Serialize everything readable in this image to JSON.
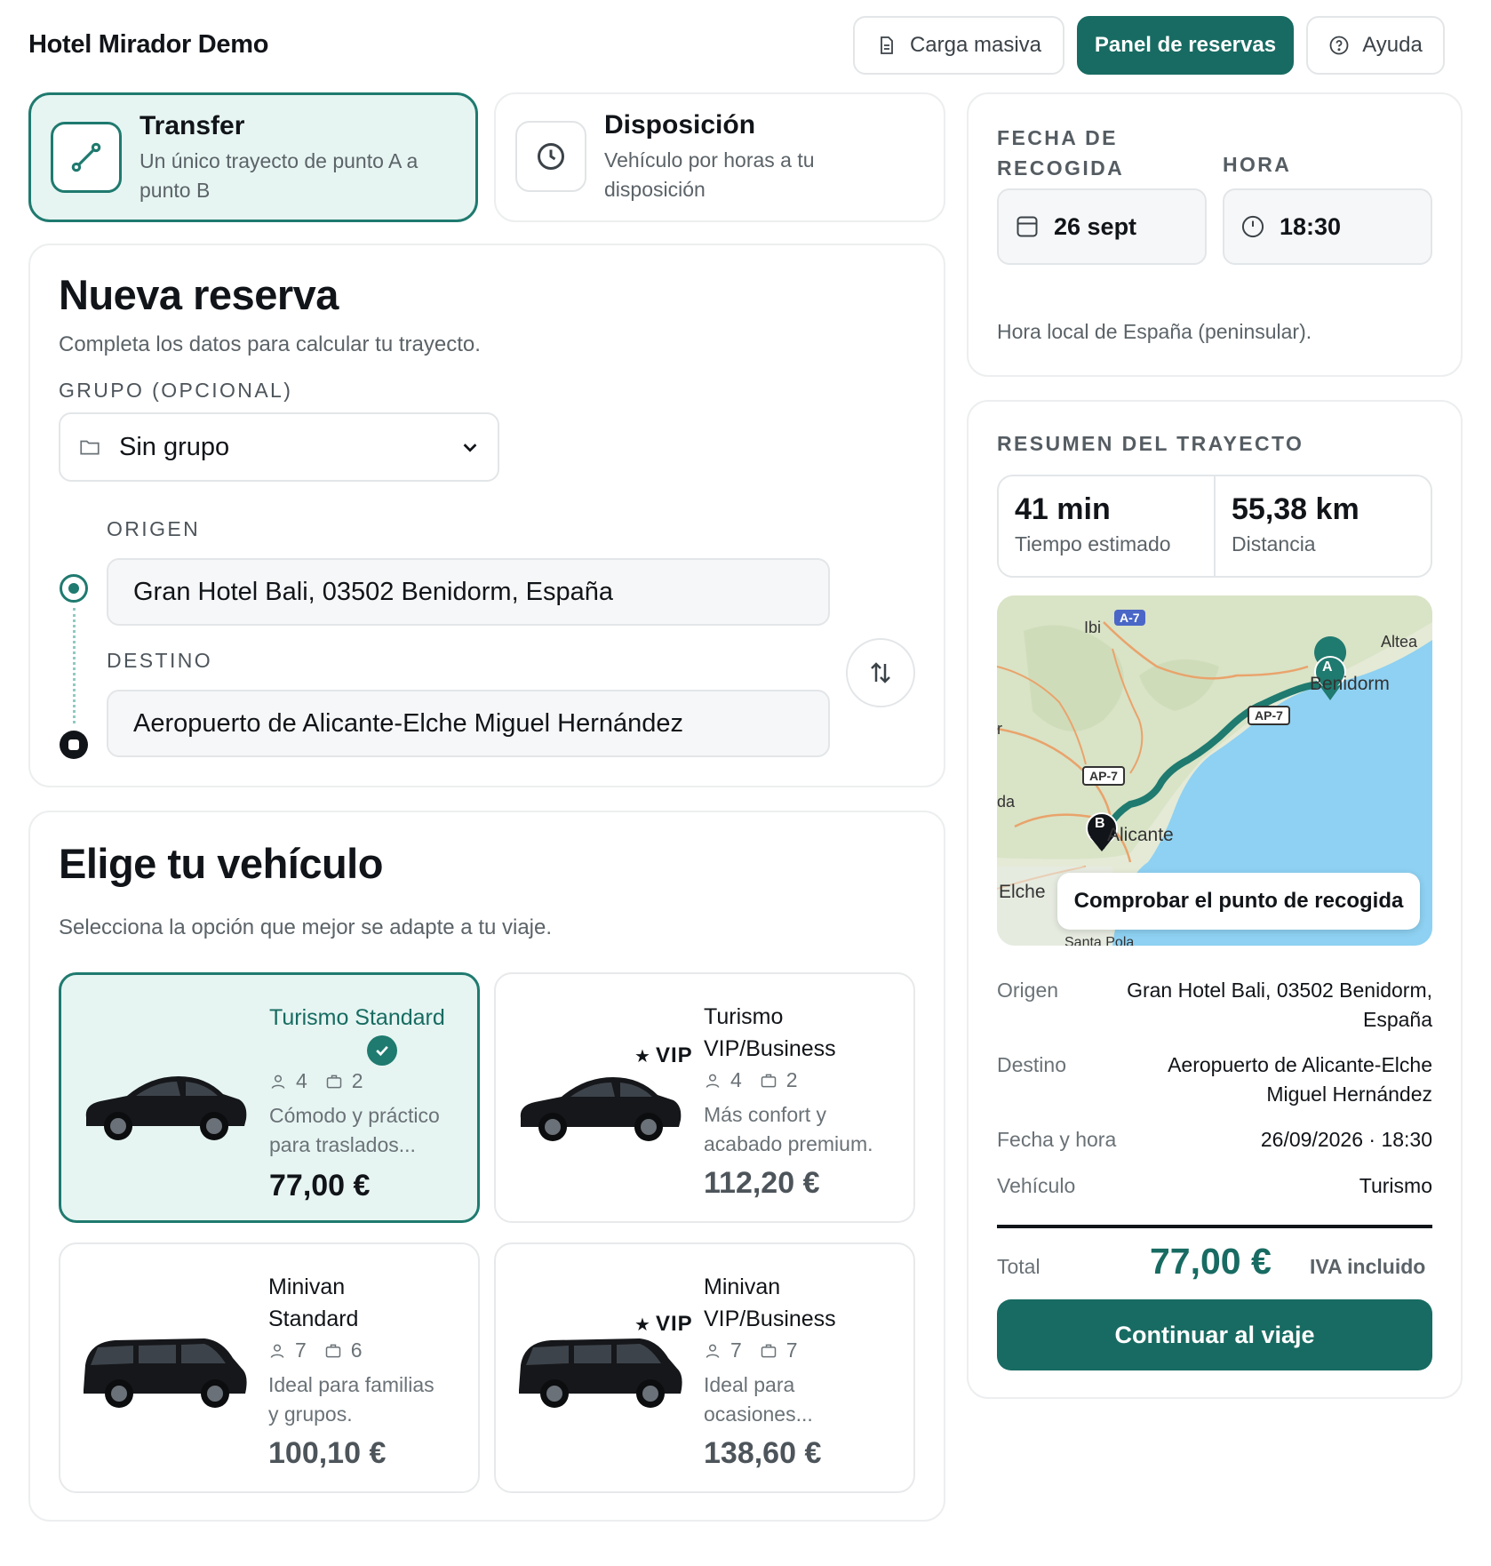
{
  "header": {
    "brand": "Hotel Mirador Demo",
    "bulk_label": "Carga masiva",
    "panel_label": "Panel de reservas",
    "help_label": "Ayuda"
  },
  "service_types": [
    {
      "title": "Transfer",
      "desc": "Un único trayecto de punto A a punto B",
      "selected": true
    },
    {
      "title": "Disposición",
      "desc": "Vehículo por horas a tu disposición",
      "selected": false
    }
  ],
  "new_booking": {
    "title": "Nueva reserva",
    "subtitle": "Completa los datos para calcular tu trayecto.",
    "group_label": "GRUPO (OPCIONAL)",
    "group_value": "Sin grupo",
    "origin_label": "ORIGEN",
    "origin_value": "Gran Hotel Bali, 03502 Benidorm, España",
    "destination_label": "DESTINO",
    "destination_value": "Aeropuerto de Alicante-Elche Miguel Hernández"
  },
  "vehicles_section": {
    "title": "Elige tu vehículo",
    "subtitle": "Selecciona la opción que mejor se adapte a tu viaje.",
    "vip_label": "VIP",
    "items": [
      {
        "name": "Turismo Standard",
        "pax": "4",
        "bags": "2",
        "desc_l1": "Cómodo y práctico",
        "desc_l2": "para traslados...",
        "price": "77,00 €",
        "selected": true,
        "vip": false
      },
      {
        "name_l1": "Turismo",
        "name_l2": "VIP/Business",
        "pax": "4",
        "bags": "2",
        "desc_l1": "Más confort y",
        "desc_l2": "acabado premium.",
        "price": "112,20 €",
        "selected": false,
        "vip": true
      },
      {
        "name_l1": "Minivan",
        "name_l2": "Standard",
        "pax": "7",
        "bags": "6",
        "desc_l1": "Ideal para familias",
        "desc_l2": "y grupos.",
        "price": "100,10 €",
        "selected": false,
        "vip": false
      },
      {
        "name_l1": "Minivan",
        "name_l2": "VIP/Business",
        "pax": "7",
        "bags": "7",
        "desc_l1": "Ideal para",
        "desc_l2": "ocasiones...",
        "price": "138,60 €",
        "selected": false,
        "vip": true
      }
    ]
  },
  "pickup": {
    "date_label_l1": "FECHA DE",
    "date_label_l2": "RECOGIDA",
    "time_label": "HORA",
    "date_value": "26 sept",
    "time_value": "18:30",
    "note": "Hora local de España (peninsular)."
  },
  "summary": {
    "title": "RESUMEN DEL TRAYECTO",
    "time_value": "41 min",
    "time_label": "Tiempo estimado",
    "distance_value": "55,38 km",
    "distance_label": "Distancia",
    "map": {
      "check_pickup_label": "Comprobar el punto de recogida",
      "marker_a": "A",
      "marker_b": "B",
      "places": [
        "Ibi",
        "Altea",
        "Benidorm",
        "Alicante",
        "Elche",
        "Santa Pola",
        "r",
        "da"
      ],
      "roads": [
        "A-7",
        "AP-7",
        "AP-7"
      ]
    },
    "rows": {
      "origin_key": "Origen",
      "origin_l1": "Gran Hotel Bali, 03502 Benidorm,",
      "origin_l2": "España",
      "dest_key": "Destino",
      "dest_l1": "Aeropuerto de Alicante-Elche",
      "dest_l2": "Miguel Hernández",
      "datetime_key": "Fecha y hora",
      "datetime_value": "26/09/2026 · 18:30",
      "vehicle_key": "Vehículo",
      "vehicle_value": "Turismo"
    },
    "total_label": "Total",
    "total_value": "77,00 €",
    "vat_label": "IVA incluido",
    "continue_label": "Continuar al viaje"
  },
  "colors": {
    "accent": "#186b62",
    "accent_light": "#e6f5f2",
    "map_sea": "#8ed1f2",
    "map_land": "#e6ecd8"
  }
}
